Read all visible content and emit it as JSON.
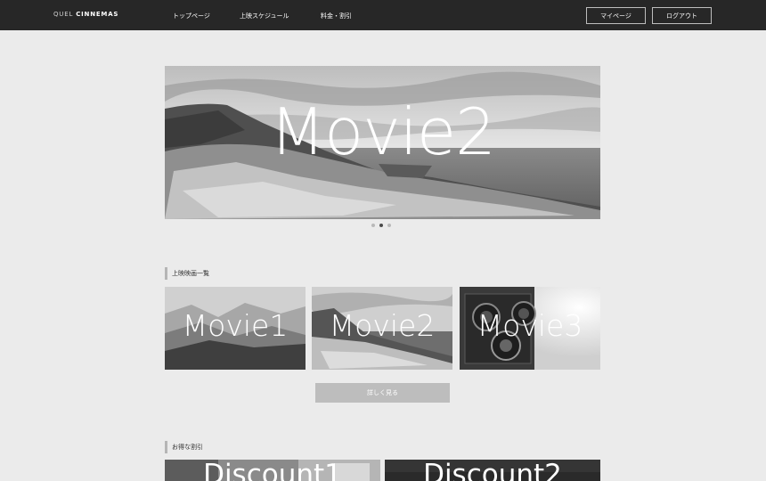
{
  "header": {
    "brand_light": "QUEL",
    "brand_bold": "CINNEMAS",
    "nav": [
      "トップページ",
      "上映スケジュール",
      "料金・割引"
    ],
    "mypage_label": "マイページ",
    "logout_label": "ログアウト"
  },
  "hero": {
    "title": "Movie2",
    "slide_count": 3,
    "active_slide": 2
  },
  "now_showing": {
    "heading": "上映映画一覧",
    "movies": [
      {
        "title": "Movie1"
      },
      {
        "title": "Movie2"
      },
      {
        "title": "Movie3"
      }
    ],
    "more_label": "詳しく見る"
  },
  "discounts": {
    "heading": "お得な割引",
    "items": [
      {
        "title": "Discount1"
      },
      {
        "title": "Discount2"
      }
    ]
  },
  "colors": {
    "header_bg": "#272727",
    "page_bg": "#ebebeb",
    "button_grey": "#bdbdbd"
  }
}
